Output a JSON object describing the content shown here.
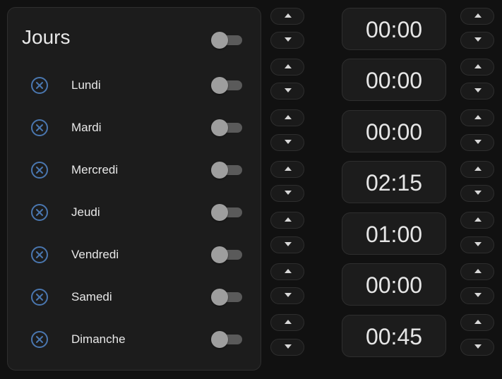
{
  "card": {
    "title": "Jours",
    "master_toggle_on": false,
    "days": [
      {
        "label": "Lundi",
        "on": false
      },
      {
        "label": "Mardi",
        "on": false
      },
      {
        "label": "Mercredi",
        "on": false
      },
      {
        "label": "Jeudi",
        "on": false
      },
      {
        "label": "Vendredi",
        "on": false
      },
      {
        "label": "Samedi",
        "on": false
      },
      {
        "label": "Dimanche",
        "on": false
      }
    ]
  },
  "times": [
    "00:00",
    "00:00",
    "00:00",
    "02:15",
    "01:00",
    "00:00",
    "00:45"
  ],
  "colors": {
    "background": "#111111",
    "card": "#1c1c1c",
    "icon_accent": "#4a77b0",
    "toggle_knob": "#9e9e9e",
    "toggle_track": "#5a5a5a",
    "text": "#e8e8e8"
  },
  "icons": {
    "day_remove": "close-circle-icon",
    "up": "arrow-up-icon",
    "down": "arrow-down-icon"
  }
}
